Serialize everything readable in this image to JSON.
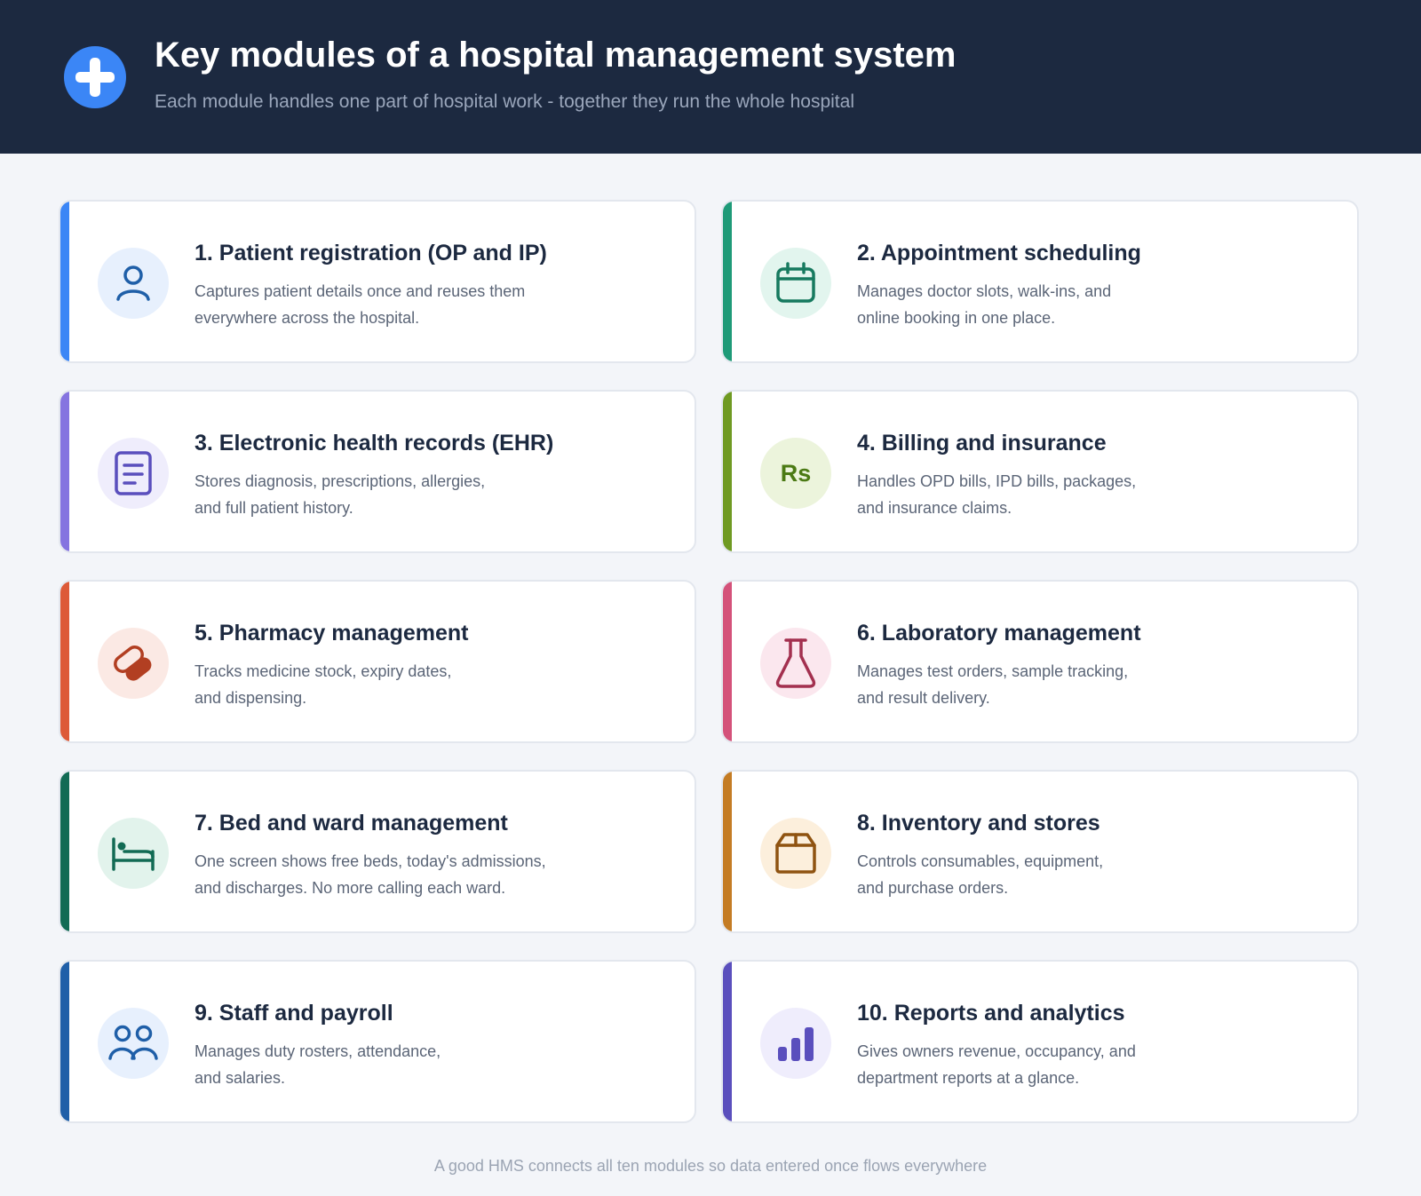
{
  "header": {
    "title": "Key modules of a hospital management system",
    "subtitle": "Each module handles one part of hospital work - together they run the whole hospital",
    "icon": "plus-icon",
    "icon_color": "#3b86f6"
  },
  "modules": [
    {
      "title": "1. Patient registration (OP and IP)",
      "line1": "Captures patient details once and reuses them",
      "line2": "everywhere across the hospital.",
      "icon": "person-icon",
      "accent": "#3b86f6"
    },
    {
      "title": "2. Appointment scheduling",
      "line1": "Manages doctor slots, walk-ins, and",
      "line2": "online booking in one place.",
      "icon": "calendar-icon",
      "accent": "#1e9a78"
    },
    {
      "title": "3. Electronic health records (EHR)",
      "line1": "Stores diagnosis, prescriptions, allergies,",
      "line2": "and full patient history.",
      "icon": "document-icon",
      "accent": "#8574e0"
    },
    {
      "title": "4. Billing and insurance",
      "line1": "Handles OPD bills, IPD bills, packages,",
      "line2": "and insurance claims.",
      "icon": "rupee-icon",
      "icon_text": "Rs",
      "accent": "#6f9a22"
    },
    {
      "title": "5. Pharmacy management",
      "line1": "Tracks medicine stock, expiry dates,",
      "line2": "and dispensing.",
      "icon": "pill-icon",
      "accent": "#dd5a38"
    },
    {
      "title": "6. Laboratory management",
      "line1": "Manages test orders, sample tracking,",
      "line2": "and result delivery.",
      "icon": "flask-icon",
      "accent": "#d4527a"
    },
    {
      "title": "7. Bed and ward management",
      "line1": "One screen shows free beds, today's admissions,",
      "line2": "and discharges. No more calling each ward.",
      "icon": "bed-icon",
      "accent": "#126b54"
    },
    {
      "title": "8. Inventory and stores",
      "line1": "Controls consumables, equipment,",
      "line2": "and purchase orders.",
      "icon": "box-icon",
      "accent": "#c47c24"
    },
    {
      "title": "9. Staff and payroll",
      "line1": "Manages duty rosters, attendance,",
      "line2": "and salaries.",
      "icon": "people-icon",
      "accent": "#1f5fa8"
    },
    {
      "title": "10. Reports and analytics",
      "line1": "Gives owners revenue, occupancy, and",
      "line2": "department reports at a glance.",
      "icon": "bar-chart-icon",
      "accent": "#5a4fbd"
    }
  ],
  "footer": "A good HMS connects all ten modules so data entered once flows everywhere"
}
